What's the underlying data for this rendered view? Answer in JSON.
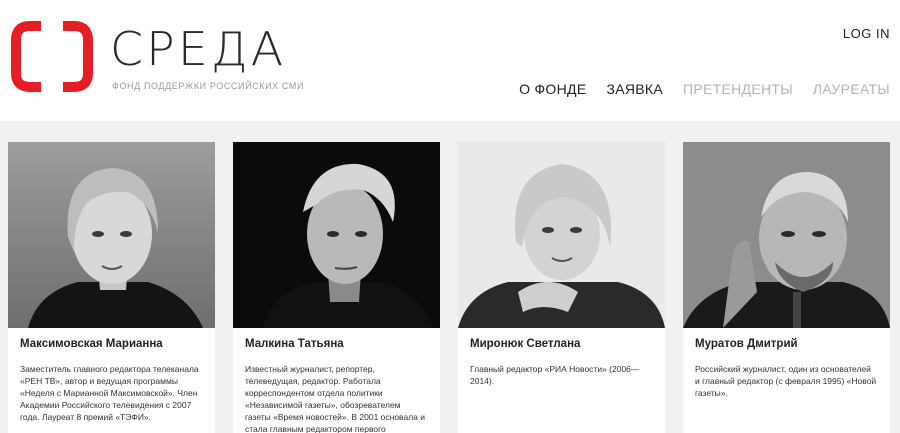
{
  "brand": {
    "name": "СРЕДА",
    "tagline": "ФОНД ПОДДЕРЖКИ РОССИЙСКИХ СМИ",
    "accent": "#e31e24"
  },
  "header": {
    "login": "LOG IN",
    "nav": [
      {
        "label": "О ФОНДЕ",
        "active": true
      },
      {
        "label": "ЗАЯВКА",
        "active": true
      },
      {
        "label": "ПРЕТЕНДЕНТЫ",
        "active": false
      },
      {
        "label": "ЛАУРЕАТЫ",
        "active": false
      }
    ]
  },
  "people": [
    {
      "name": "Максимовская Марианна",
      "bio": "Заместитель главного редактора телеканала «РЕН ТВ», автор и ведущая программы «Неделя с Марианной Максимовской». Член Академии Российского телевидения с 2007 года. Лауреат 8 премий «ТЭФИ»."
    },
    {
      "name": "Малкина Татьяна",
      "bio": "Известный журналист, репортер, телеведущая, редактор. Работала корреспондентом отдела политики «Независимой газеты», обозревателем газеты «Время новостей». В 2001 основала и стала главным редактором первого"
    },
    {
      "name": "Миронюк Светлана",
      "bio": "Главный редактор «РИА Новости» (2006—2014)."
    },
    {
      "name": "Муратов Дмитрий",
      "bio": "Российский журналист, один из основателей и главный редактор (с февраля 1995) «Новой газеты»."
    }
  ]
}
